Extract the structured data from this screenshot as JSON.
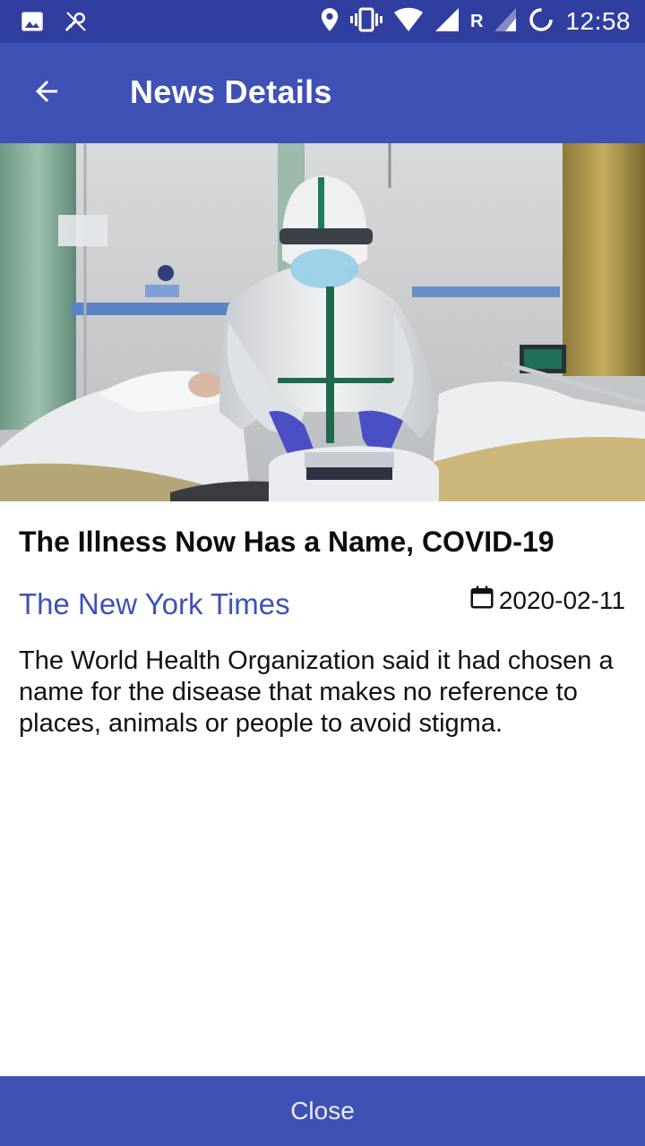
{
  "status_bar": {
    "time": "12:58",
    "network_letter": "R",
    "icons": [
      "image-icon",
      "vpn-key-icon",
      "location-icon",
      "vibrate-icon",
      "wifi-icon",
      "signal-icon",
      "roaming-signal-icon",
      "sync-icon"
    ]
  },
  "app_bar": {
    "title": "News Details",
    "back_icon": "arrow-back-icon"
  },
  "article": {
    "image_alt": "Medical worker in protective suit operating a device beside hospital beds",
    "title": "The Illness Now Has a Name, COVID-19",
    "source": "The New York Times",
    "date": "2020-02-11",
    "date_icon": "calendar-icon",
    "description": "The World Health Organization said it had chosen a name for the disease that makes no reference to places, animals or people to avoid stigma."
  },
  "footer": {
    "close_label": "Close"
  },
  "colors": {
    "status_bar": "#303f9f",
    "primary": "#3f51b5",
    "source_text": "#3f51b5"
  }
}
